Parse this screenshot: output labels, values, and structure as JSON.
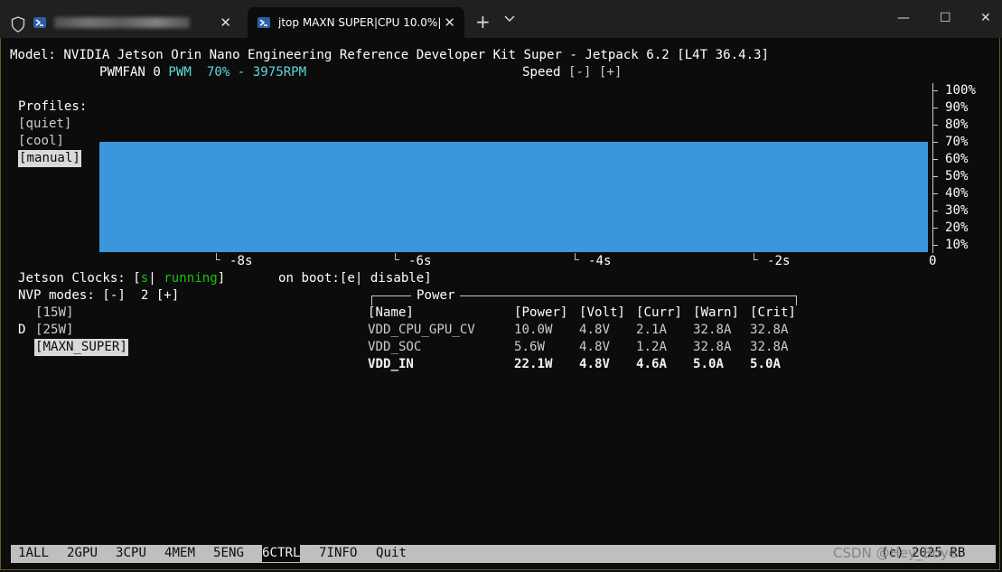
{
  "tabs": [
    {
      "label": ""
    },
    {
      "label": "jtop MAXN SUPER|CPU 10.0%|"
    }
  ],
  "window": {
    "minimize": "—",
    "maximize": "☐",
    "close": "✕"
  },
  "header": {
    "model_line": "Model: NVIDIA Jetson Orin Nano Engineering Reference Developer Kit Super - Jetpack 6.2 [L4T 36.4.3]",
    "fan_name": "PWMFAN 0",
    "fan_pwm_label": "PWM",
    "fan_value": "70% - 3975RPM",
    "speed_label": "Speed",
    "speed_minus": "[-]",
    "speed_plus": "[+]"
  },
  "profiles": {
    "title": "Profiles:",
    "items": [
      "[quiet]",
      "[cool]",
      "[manual]"
    ],
    "selected": "[manual]"
  },
  "fan_chart": {
    "y_ticks": [
      "100%",
      "90%",
      "80%",
      "70%",
      "60%",
      "50%",
      "40%",
      "30%",
      "20%",
      "10%"
    ],
    "x_ticks": [
      "-8s",
      "-6s",
      "-4s",
      "-2s",
      "0"
    ]
  },
  "chart_data": {
    "type": "area",
    "title": "",
    "xlabel": "",
    "ylabel": "",
    "x": [
      "-8s",
      "-6s",
      "-4s",
      "-2s",
      "0"
    ],
    "values": [
      70,
      70,
      70,
      70,
      70
    ],
    "ylim": [
      0,
      100
    ],
    "color": "#3b96dc"
  },
  "clocks": {
    "label": "Jetson Clocks:",
    "open": "[",
    "key": "s",
    "sep": "|",
    "status": "running",
    "close": "]",
    "boot_label": "on boot:[",
    "boot_key": "e",
    "boot_sep": "|",
    "boot_status": "disable",
    "boot_close": "]"
  },
  "nvp": {
    "label": "NVP modes:",
    "minus": "[-]",
    "number": "2",
    "plus": "[+]",
    "modes": [
      {
        "prefix": " ",
        "label": "[15W]"
      },
      {
        "prefix": "D",
        "label": "[25W]"
      },
      {
        "prefix": " ",
        "label": "[MAXN_SUPER]"
      }
    ]
  },
  "power": {
    "title": "Power",
    "headers": [
      "[Name]",
      "[Power]",
      "[Volt]",
      "[Curr]",
      "[Warn]",
      "[Crit]"
    ],
    "rows": [
      [
        "VDD_CPU_GPU_CV",
        "10.0W",
        "4.8V",
        "2.1A",
        "32.8A",
        "32.8A"
      ],
      [
        "VDD_SOC",
        "5.6W",
        "4.8V",
        "1.2A",
        "32.8A",
        "32.8A"
      ],
      [
        "VDD_IN",
        "22.1W",
        "4.8V",
        "4.6A",
        "5.0A",
        "5.0A"
      ]
    ]
  },
  "footer": {
    "items": [
      {
        "num": "1",
        "label": "ALL"
      },
      {
        "num": "2",
        "label": "GPU"
      },
      {
        "num": "3",
        "label": "CPU"
      },
      {
        "num": "4",
        "label": "MEM"
      },
      {
        "num": "5",
        "label": "ENG"
      },
      {
        "num": "6",
        "label": "CTRL"
      },
      {
        "num": "7",
        "label": "INFO"
      },
      {
        "num": "",
        "label": "Quit"
      }
    ],
    "copyright": "(c) 2025 RB"
  },
  "watermark": "CSDN @Hey_Boye",
  "colors": {
    "background": "#0c0c0c",
    "chart_fill": "#3b96dc",
    "running": "#16c60c",
    "pwm": "#61d6d6"
  }
}
